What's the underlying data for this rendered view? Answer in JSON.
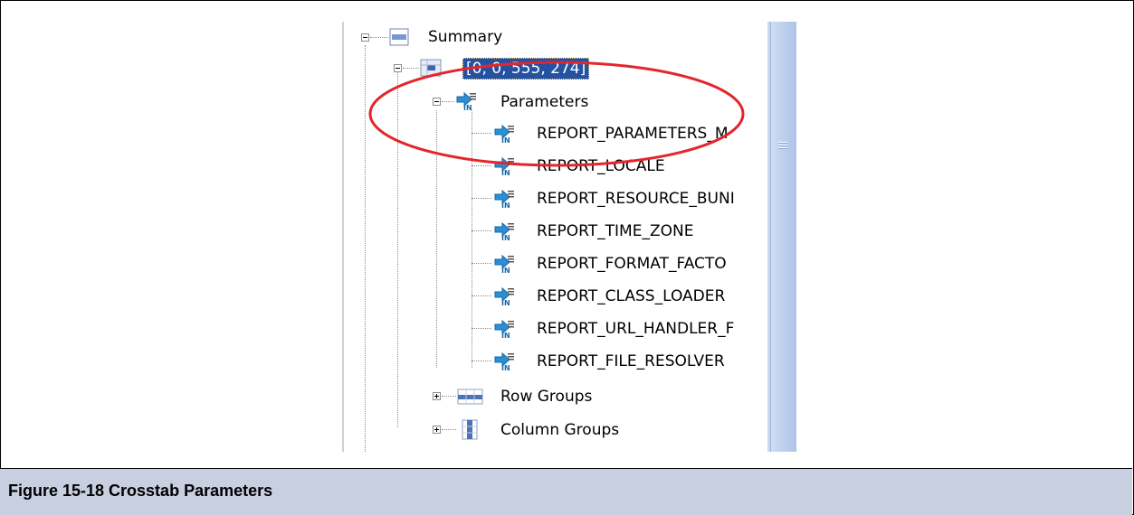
{
  "tree": {
    "root_label": "Summary",
    "cell_label": "[0, 0, 555, 274]",
    "parameters_label": "Parameters",
    "parameters": [
      "REPORT_PARAMETERS_M",
      "REPORT_LOCALE",
      "REPORT_RESOURCE_BUNI",
      "REPORT_TIME_ZONE",
      "REPORT_FORMAT_FACTO",
      "REPORT_CLASS_LOADER",
      "REPORT_URL_HANDLER_F",
      "REPORT_FILE_RESOLVER"
    ],
    "row_groups_label": "Row Groups",
    "column_groups_label": "Column Groups"
  },
  "caption": "Figure 15-18  Crosstab Parameters",
  "colors": {
    "selection": "#2452a3",
    "annotation": "#e3262b",
    "caption_bg": "#c7cfe1"
  }
}
